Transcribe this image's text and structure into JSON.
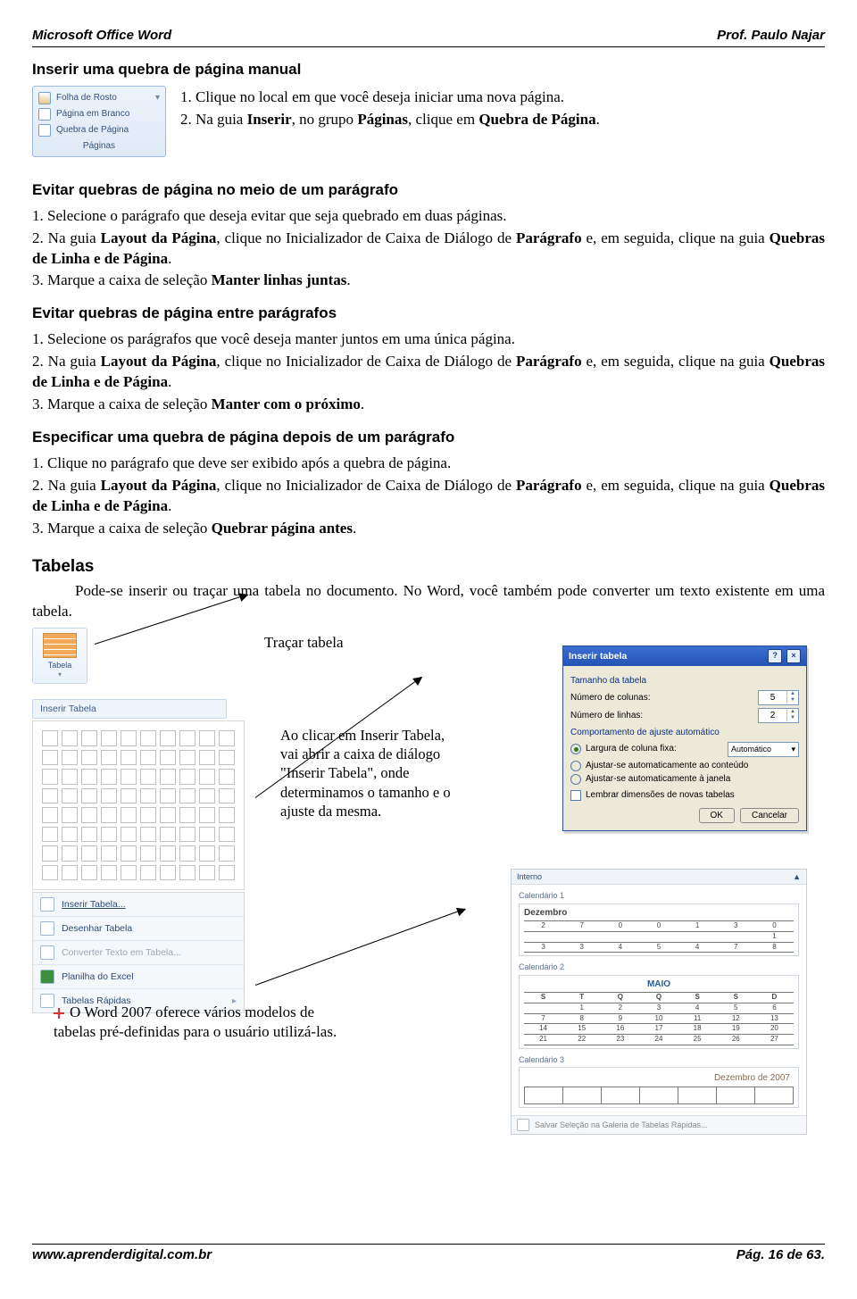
{
  "header": {
    "left": "Microsoft Office Word",
    "right": "Prof. Paulo Najar"
  },
  "footer": {
    "left": "www.aprenderdigital.com.br",
    "right": "Pág. 16 de 63."
  },
  "s1": {
    "title": "Inserir uma quebra de página manual",
    "p1": "1. Clique no local em que você deseja iniciar uma nova página.",
    "p2a": "2. Na guia ",
    "p2b": "Inserir",
    "p2c": ", no grupo ",
    "p2d": "Páginas",
    "p2e": ", clique em ",
    "p2f": "Quebra de Página",
    "p2g": "."
  },
  "ribbonPages": {
    "cover": "Folha de Rosto",
    "blank": "Página em Branco",
    "break": "Quebra de Página",
    "caption": "Páginas"
  },
  "s2": {
    "title": "Evitar quebras de página no meio de um parágrafo",
    "p1": "1. Selecione o parágrafo que deseja evitar que seja quebrado em duas páginas.",
    "p2a": "2. Na guia ",
    "p2b": "Layout da Página",
    "p2c": ", clique no Inicializador de Caixa de Diálogo de ",
    "p2d": "Parágrafo",
    "p2e": " e, em seguida, clique na guia ",
    "p2f": "Quebras de Linha e de Página",
    "p2g": ".",
    "p3a": "3. Marque a caixa de seleção ",
    "p3b": "Manter linhas juntas",
    "p3c": "."
  },
  "s3": {
    "title": "Evitar quebras de página entre parágrafos",
    "p1": "1. Selecione os parágrafos que você deseja manter juntos em uma única página.",
    "p2a": "2. Na guia ",
    "p2b": "Layout da Página",
    "p2c": ", clique no Inicializador de Caixa de Diálogo de ",
    "p2d": "Parágrafo",
    "p2e": " e, em seguida, clique na guia ",
    "p2f": "Quebras de Linha e de Página",
    "p2g": ".",
    "p3a": "3. Marque a caixa de seleção ",
    "p3b": "Manter com o próximo",
    "p3c": "."
  },
  "s4": {
    "title": "Especificar uma quebra de página depois de um parágrafo",
    "p1": "1. Clique no parágrafo que deve ser exibido após a quebra de página.",
    "p2a": "2. Na guia ",
    "p2b": "Layout da Página",
    "p2c": ", clique no Inicializador de Caixa de Diálogo de ",
    "p2d": "Parágrafo",
    "p2e": " e, em seguida, clique na guia ",
    "p2f": "Quebras de Linha e de Página",
    "p2g": ".",
    "p3a": "3. Marque a caixa de seleção ",
    "p3b": "Quebrar página antes",
    "p3c": "."
  },
  "tables": {
    "title": "Tabelas",
    "intro": "Pode-se inserir ou traçar uma tabela no documento. No Word, você também pode converter um texto existente em uma tabela.",
    "caption": "Traçar tabela",
    "ribbonLabel": "Tabela",
    "dropLabel": "Inserir Tabela",
    "menu": {
      "ins": "Inserir Tabela...",
      "draw": "Desenhar Tabela",
      "conv": "Converter Texto em Tabela...",
      "excel": "Planilha do Excel",
      "quick": "Tabelas Rápidas"
    },
    "note": "Ao clicar em Inserir Tabela, vai abrir a caixa de diálogo \"Inserir Tabela\", onde determinamos o tamanho e o ajuste da mesma.",
    "bullet": "O Word 2007 oferece vários modelos de tabelas pré-definidas para o usuário utilizá-las."
  },
  "dialog": {
    "title": "Inserir tabela",
    "grpSize": "Tamanho da tabela",
    "cols": "Número de colunas:",
    "colsVal": "5",
    "rows": "Número de linhas:",
    "rowsVal": "2",
    "grpAuto": "Comportamento de ajuste automático",
    "r1": "Largura de coluna fixa:",
    "r1val": "Automático",
    "r2": "Ajustar-se automaticamente ao conteúdo",
    "r3": "Ajustar-se automaticamente à janela",
    "chk": "Lembrar dimensões de novas tabelas",
    "ok": "OK",
    "cancel": "Cancelar"
  },
  "gallery": {
    "top": "Interno",
    "sec1": "Calendário 1",
    "t1Title": "Dezembro",
    "sec2": "Calendário 2",
    "t2Title": "MAIO",
    "sec3": "Calendário 3",
    "t3Title": "Dezembro de 2007",
    "ftr": "Salvar Seleção na Galeria de Tabelas Rápidas...",
    "weekdays": [
      "S",
      "T",
      "Q",
      "Q",
      "S",
      "S",
      "D"
    ],
    "dec_r1": [
      "2",
      "7",
      "0",
      "0",
      "1",
      "3",
      "0"
    ],
    "dec_r2": [
      "",
      "",
      "",
      "",
      "",
      "",
      "1"
    ],
    "dec_r3": [
      "3",
      "3",
      "4",
      "5",
      "4",
      "7",
      "8"
    ],
    "maio_r1": [
      "",
      "1",
      "2",
      "3",
      "4",
      "5",
      "6"
    ],
    "maio_r2": [
      "7",
      "8",
      "9",
      "10",
      "11",
      "12",
      "13"
    ],
    "maio_r3": [
      "14",
      "15",
      "16",
      "17",
      "18",
      "19",
      "20"
    ],
    "maio_r4": [
      "21",
      "22",
      "23",
      "24",
      "25",
      "26",
      "27"
    ]
  }
}
